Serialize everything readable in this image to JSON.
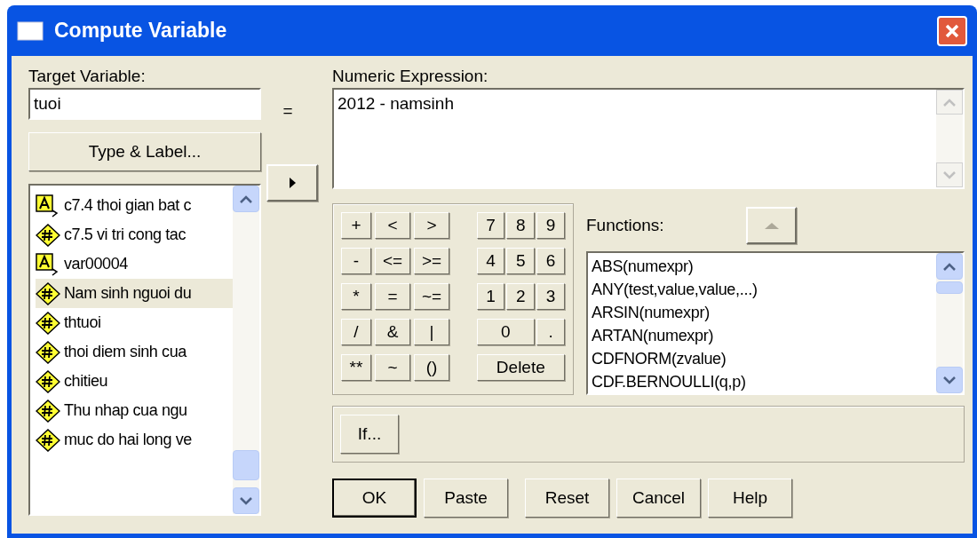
{
  "window": {
    "title": "Compute Variable"
  },
  "target_variable": {
    "label": "Target Variable:",
    "value": "tuoi"
  },
  "equals": "=",
  "type_label_button": "Type & Label...",
  "variables": [
    {
      "kind": "string",
      "label": "c7.4 thoi gian bat c",
      "selected": false
    },
    {
      "kind": "numeric",
      "label": "c7.5 vi tri cong tac",
      "selected": false
    },
    {
      "kind": "string",
      "label": "var00004",
      "selected": false
    },
    {
      "kind": "numeric",
      "label": "Nam sinh nguoi du",
      "selected": true
    },
    {
      "kind": "numeric",
      "label": "thtuoi",
      "selected": false
    },
    {
      "kind": "numeric",
      "label": "thoi diem sinh cua",
      "selected": false
    },
    {
      "kind": "numeric",
      "label": "chitieu",
      "selected": false
    },
    {
      "kind": "numeric",
      "label": "Thu nhap cua ngu",
      "selected": false
    },
    {
      "kind": "numeric",
      "label": "muc do hai long ve",
      "selected": false
    }
  ],
  "numeric_expression": {
    "label": "Numeric Expression:",
    "value": "2012 - namsinh"
  },
  "keypad": [
    {
      "ops": [
        "+",
        "<",
        ">"
      ],
      "digits": [
        "7",
        "8",
        "9"
      ]
    },
    {
      "ops": [
        "-",
        "<=",
        ">="
      ],
      "digits": [
        "4",
        "5",
        "6"
      ]
    },
    {
      "ops": [
        "*",
        "=",
        "~="
      ],
      "digits": [
        "1",
        "2",
        "3"
      ]
    },
    {
      "ops": [
        "/",
        "&",
        "|"
      ],
      "digits": [
        "0",
        "."
      ]
    },
    {
      "ops": [
        "**",
        "~",
        "()"
      ],
      "digits": [
        "Delete"
      ]
    }
  ],
  "functions": {
    "label": "Functions:",
    "items": [
      "ABS(numexpr)",
      "ANY(test,value,value,...)",
      "ARSIN(numexpr)",
      "ARTAN(numexpr)",
      "CDFNORM(zvalue)",
      "CDF.BERNOULLI(q,p)"
    ]
  },
  "if_button": "If...",
  "buttons": [
    {
      "label": "OK",
      "default": true
    },
    {
      "label": "Paste",
      "default": false
    },
    {
      "label": "Reset",
      "default": false
    },
    {
      "label": "Cancel",
      "default": false
    },
    {
      "label": "Help",
      "default": false
    }
  ]
}
